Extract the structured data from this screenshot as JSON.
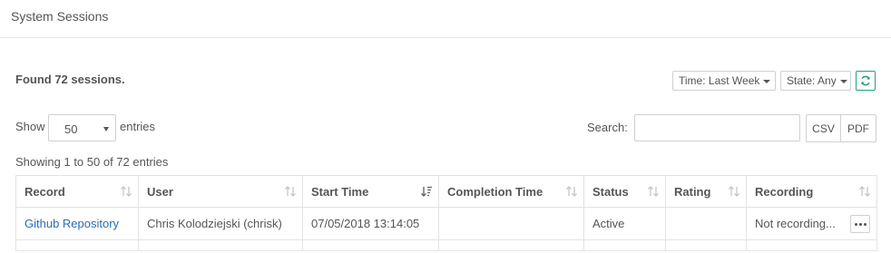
{
  "page": {
    "title": "System Sessions"
  },
  "summary": {
    "found_text": "Found 72 sessions."
  },
  "filters": {
    "time_label": "Time: Last Week",
    "state_label": "State: Any",
    "refresh_icon": "refresh-icon",
    "accent_color": "#27a07a"
  },
  "length": {
    "show_label": "Show",
    "value": "50",
    "entries_label": "entries"
  },
  "search": {
    "label": "Search:",
    "value": ""
  },
  "export": {
    "csv_label": "CSV",
    "pdf_label": "PDF"
  },
  "info": {
    "text": "Showing 1 to 50 of 72 entries"
  },
  "table": {
    "columns": [
      {
        "label": "Record",
        "sort": "unsorted"
      },
      {
        "label": "User",
        "sort": "unsorted"
      },
      {
        "label": "Start Time",
        "sort": "descending"
      },
      {
        "label": "Completion Time",
        "sort": "unsorted"
      },
      {
        "label": "Status",
        "sort": "unsorted"
      },
      {
        "label": "Rating",
        "sort": "unsorted"
      },
      {
        "label": "Recording",
        "sort": "unsorted"
      }
    ],
    "rows": [
      {
        "record": "Github Repository",
        "user": "Chris Kolodziejski (chrisk)",
        "start_time": "07/05/2018 13:14:05",
        "completion_time": "",
        "status": "Active",
        "rating": "",
        "recording": "Not recording..."
      }
    ],
    "link_color": "#2a6db3"
  }
}
